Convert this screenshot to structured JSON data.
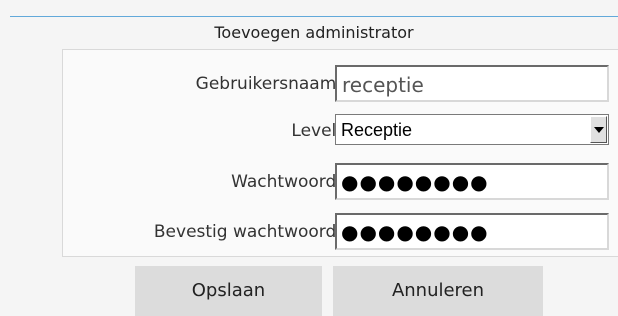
{
  "form": {
    "title": "Toevoegen administrator",
    "fields": {
      "username": {
        "label": "Gebruikersnaam:",
        "value": "receptie"
      },
      "level": {
        "label": "Level:",
        "selected": "Receptie"
      },
      "password": {
        "label": "Wachtwoord:",
        "masked": "●●●●●●●●"
      },
      "confirm": {
        "label": "Bevestig wachtwoord:",
        "masked": "●●●●●●●●"
      }
    },
    "buttons": {
      "save": "Opslaan",
      "cancel": "Annuleren"
    }
  },
  "colors": {
    "accent_line": "#62a9da",
    "button_bg": "#dcdcdc"
  }
}
